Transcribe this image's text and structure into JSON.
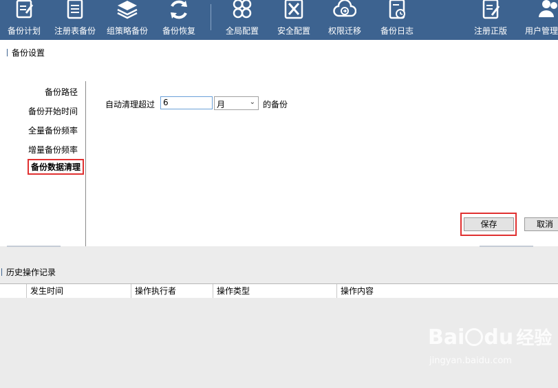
{
  "toolbar": {
    "buttons": [
      {
        "label": "备份计划",
        "icon": "backup-plan-icon"
      },
      {
        "label": "注册表备份",
        "icon": "registry-backup-icon"
      },
      {
        "label": "组策略备份",
        "icon": "group-policy-icon"
      },
      {
        "label": "备份恢复",
        "icon": "restore-icon"
      },
      {
        "label": "全局配置",
        "icon": "global-config-icon"
      },
      {
        "label": "安全配置",
        "icon": "security-config-icon"
      },
      {
        "label": "权限迁移",
        "icon": "permission-migrate-icon"
      },
      {
        "label": "备份日志",
        "icon": "backup-log-icon"
      },
      {
        "label": "注册正版",
        "icon": "register-icon"
      },
      {
        "label": "用户管理",
        "icon": "user-manage-icon"
      }
    ]
  },
  "settings": {
    "title": "备份设置",
    "nav": [
      "备份路径",
      "备份开始时间",
      "全量备份频率",
      "增量备份频率",
      "备份数据清理"
    ],
    "active_index": 4,
    "cleanup": {
      "label_before": "自动清理超过",
      "value": "6",
      "unit": "月",
      "label_after": "的备份"
    },
    "save_label": "保存",
    "cancel_label": "取消"
  },
  "history": {
    "title": "历史操作记录",
    "columns": [
      "",
      "发生时间",
      "操作执行者",
      "操作类型",
      "操作内容"
    ]
  },
  "watermark": {
    "brand": "Bai",
    "brand2": "du",
    "cn": "经验",
    "url": "jingyan.baidu.com"
  },
  "colors": {
    "toolbar_bg": "#3d6390",
    "highlight": "#e03030"
  }
}
